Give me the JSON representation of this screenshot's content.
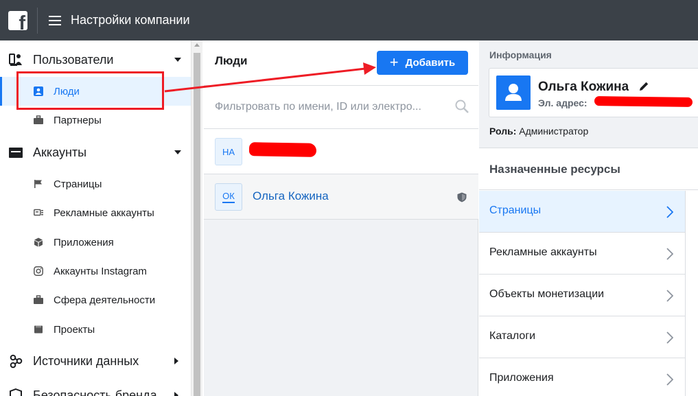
{
  "topbar": {
    "title": "Настройки компании",
    "logo_letter": "f"
  },
  "sidebar": {
    "sections": [
      {
        "label": "Пользователи",
        "icon": "users-icon",
        "items": [
          {
            "label": "Люди",
            "icon": "person-badge-icon",
            "active": true
          },
          {
            "label": "Партнеры",
            "icon": "briefcase-icon"
          }
        ]
      },
      {
        "label": "Аккаунты",
        "icon": "inbox-icon",
        "items": [
          {
            "label": "Страницы",
            "icon": "flag-icon"
          },
          {
            "label": "Рекламные аккаунты",
            "icon": "ad-account-icon"
          },
          {
            "label": "Приложения",
            "icon": "cube-icon"
          },
          {
            "label": "Аккаунты Instagram",
            "icon": "instagram-icon"
          },
          {
            "label": "Сфера деятельности",
            "icon": "briefcase-icon"
          },
          {
            "label": "Проекты",
            "icon": "folder-icon"
          }
        ]
      },
      {
        "label": "Источники данных",
        "icon": "data-sources-icon"
      },
      {
        "label": "Безопасность бренда",
        "icon": "shield-icon"
      }
    ]
  },
  "people": {
    "title": "Люди",
    "add_button": "Добавить",
    "filter_placeholder": "Фильтровать по имени, ID или электро...",
    "list": [
      {
        "initials": "НА",
        "name": ""
      },
      {
        "initials": "ОК",
        "name": "Ольга Кожина",
        "admin": true
      }
    ]
  },
  "details": {
    "info_label": "Информация",
    "name": "Ольга Кожина",
    "email_label": "Эл. адрес:",
    "role_label": "Роль:",
    "role_value": "Администратор",
    "assigned_title": "Назначенные ресурсы",
    "assets": [
      {
        "label": "Страницы",
        "active": true
      },
      {
        "label": "Рекламные аккаунты"
      },
      {
        "label": "Объекты монетизации"
      },
      {
        "label": "Каталоги"
      },
      {
        "label": "Приложения"
      }
    ]
  },
  "colors": {
    "topbar": "#3b4148",
    "accent": "#1877f2",
    "annotation": "#ee1c25"
  }
}
